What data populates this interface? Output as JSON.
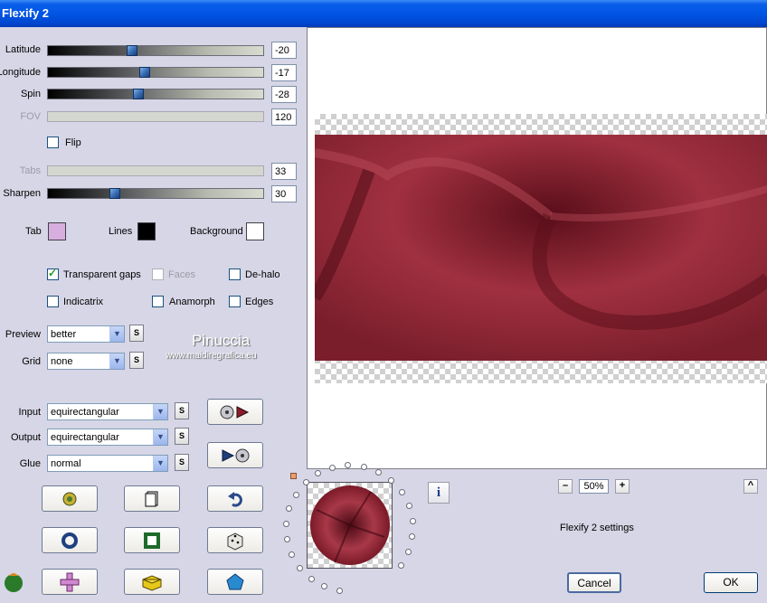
{
  "window": {
    "title": "Flexify 2"
  },
  "sliders": [
    {
      "label": "Latitude",
      "value": "-20",
      "level": 0.39,
      "enabled": true
    },
    {
      "label": "Longitude",
      "value": "-17",
      "level": 0.45,
      "enabled": true
    },
    {
      "label": "Spin",
      "value": "-28",
      "level": 0.42,
      "enabled": true
    },
    {
      "label": "FOV",
      "value": "120",
      "level": null,
      "enabled": false
    },
    {
      "label": "Tabs",
      "value": "33",
      "level": null,
      "enabled": false
    },
    {
      "label": "Sharpen",
      "value": "30",
      "level": 0.31,
      "enabled": true
    }
  ],
  "flip": {
    "label": "Flip",
    "checked": false
  },
  "colors": {
    "tab_label": "Tab",
    "tab_color": "#d8aede",
    "lines_label": "Lines",
    "lines_color": "#000000",
    "background_label": "Background",
    "background_color": "#ffffff",
    "preview_surface": "#9a2f3e"
  },
  "checkboxes": {
    "transparent_gaps": {
      "label": "Transparent gaps",
      "checked": true
    },
    "faces": {
      "label": "Faces",
      "checked": false,
      "enabled": false
    },
    "de_halo": {
      "label": "De-halo",
      "checked": false
    },
    "indicatrix": {
      "label": "Indicatrix",
      "checked": false
    },
    "anamorph": {
      "label": "Anamorph",
      "checked": false
    },
    "edges": {
      "label": "Edges",
      "checked": false
    }
  },
  "selects": {
    "preview": {
      "label": "Preview",
      "value": "better"
    },
    "grid": {
      "label": "Grid",
      "value": "none"
    },
    "input": {
      "label": "Input",
      "value": "equirectangular"
    },
    "output": {
      "label": "Output",
      "value": "equirectangular"
    },
    "glue": {
      "label": "Glue",
      "value": "normal"
    }
  },
  "s_button_label": "S",
  "watermark": {
    "name": "Pinuccia",
    "url": "www.maidiregrafica.eu"
  },
  "zoom": {
    "minus": "–",
    "value": "50%",
    "plus": "+"
  },
  "collapse_label": "^",
  "info_label": "i",
  "settings_label": "Flexify 2 settings",
  "cancel_label": "Cancel",
  "ok_label": "OK"
}
